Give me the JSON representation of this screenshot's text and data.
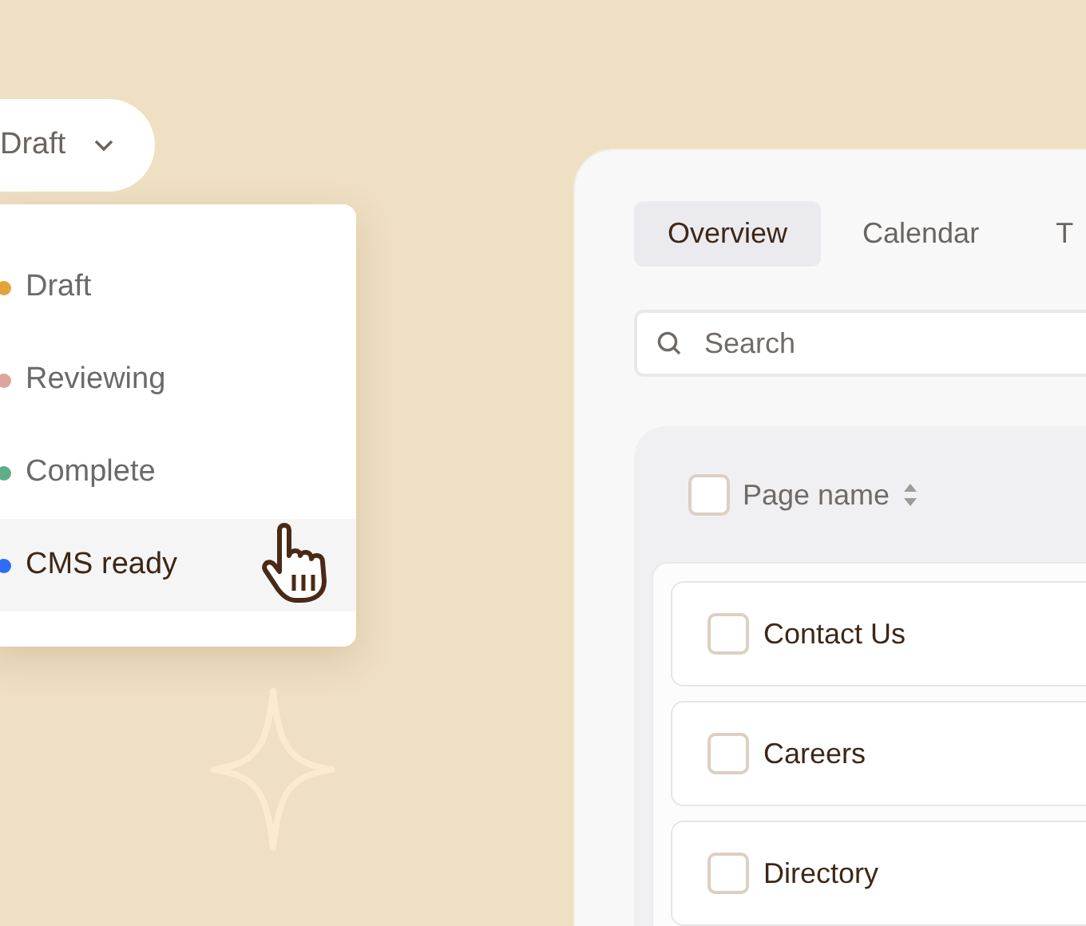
{
  "status_select": {
    "value": "Draft"
  },
  "status_menu": [
    {
      "label": "Draft",
      "color": "#e3a43c",
      "selected": false
    },
    {
      "label": "Reviewing",
      "color": "#dea59c",
      "selected": false
    },
    {
      "label": "Complete",
      "color": "#5eae8a",
      "selected": false
    },
    {
      "label": "CMS ready",
      "color": "#2f6df6",
      "selected": true
    }
  ],
  "tabs": [
    {
      "label": "Overview",
      "selected": true
    },
    {
      "label": "Calendar",
      "selected": false
    },
    {
      "label": "T",
      "selected": false
    }
  ],
  "search": {
    "placeholder": "Search"
  },
  "table": {
    "columns": [
      "Page name"
    ],
    "all_checked": false,
    "rows": [
      {
        "name": "Contact Us",
        "checked": false
      },
      {
        "name": "Careers",
        "checked": false
      },
      {
        "name": "Directory",
        "checked": false
      }
    ]
  }
}
